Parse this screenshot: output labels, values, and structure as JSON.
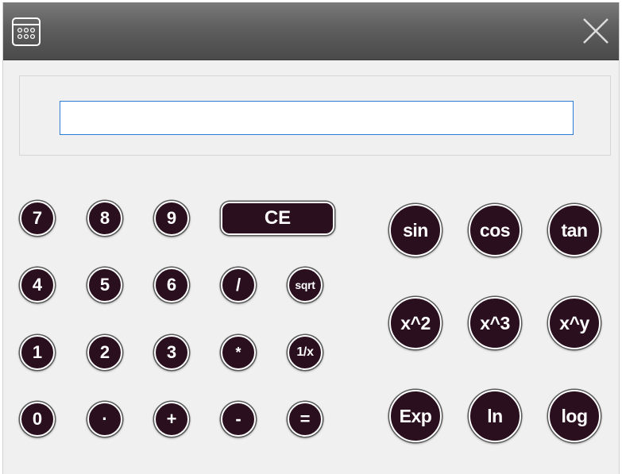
{
  "window": {
    "icon": "calculator-icon",
    "close_icon": "close-icon",
    "colors": {
      "titlebar": "#4f4f4f",
      "button_fill": "#2a0f1f",
      "input_border": "#2e7bd4"
    }
  },
  "display": {
    "value": ""
  },
  "keys": {
    "n7": "7",
    "n8": "8",
    "n9": "9",
    "ce": "CE",
    "n4": "4",
    "n5": "5",
    "n6": "6",
    "divide": "/",
    "sqrt": "sqrt",
    "n1": "1",
    "n2": "2",
    "n3": "3",
    "multiply": "*",
    "reciprocal": "1/x",
    "n0": "0",
    "dot": "·",
    "plus": "+",
    "minus": "-",
    "equals": "="
  },
  "functions": {
    "sin": "sin",
    "cos": "cos",
    "tan": "tan",
    "square": "x^2",
    "cube": "x^3",
    "power": "x^y",
    "exp": "Exp",
    "ln": "ln",
    "log": "log"
  }
}
